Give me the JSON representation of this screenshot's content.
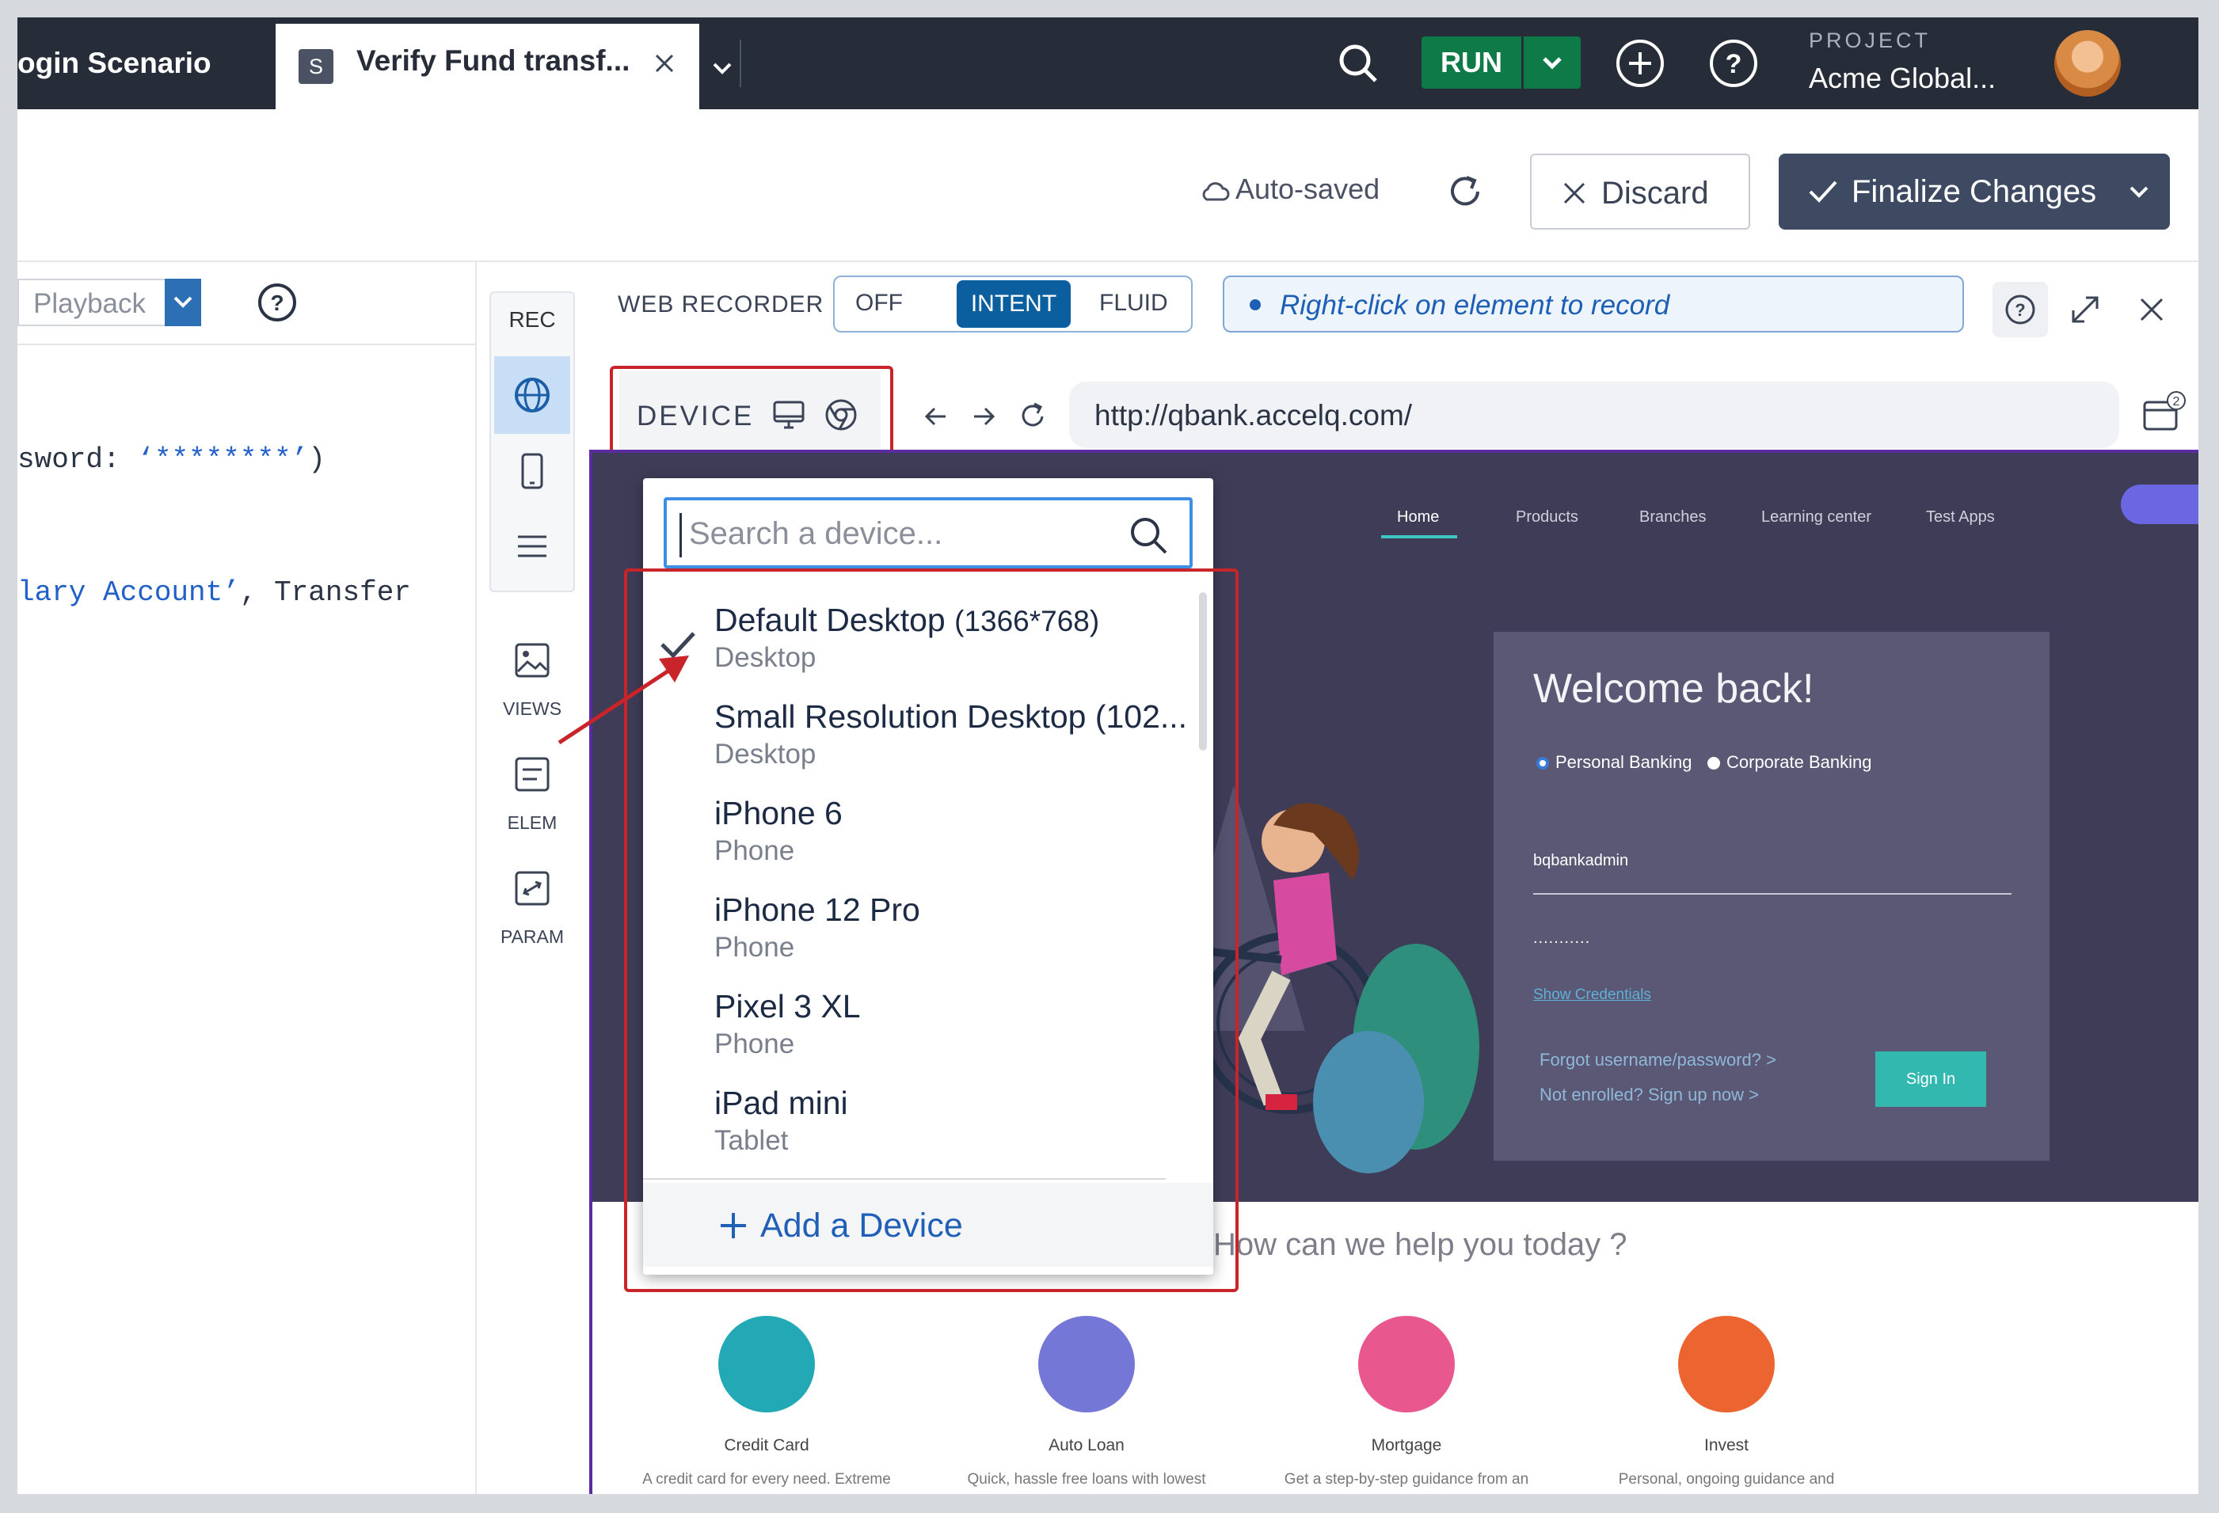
{
  "topbar": {
    "prev_tab": "ogin Scenario",
    "active_tab_badge": "S",
    "active_tab_title": "Verify Fund transf...",
    "run_label": "RUN",
    "project_label": "PROJECT",
    "project_name": "Acme Global..."
  },
  "toolbar": {
    "autosave": "Auto-saved",
    "discard": "Discard",
    "finalize": "Finalize Changes"
  },
  "editor": {
    "playback": "Playback",
    "lines": [
      {
        "pre": "sword: ",
        "str": "‘********’",
        "post": ")"
      },
      {
        "pre": "",
        "str": "lary Account’",
        "post": ", Transfer"
      }
    ]
  },
  "rail": {
    "rec": "REC",
    "views": "VIEWS",
    "elem": "ELEM",
    "param": "PARAM"
  },
  "recorder": {
    "title": "WEB RECORDER",
    "modes": [
      "OFF",
      "INTENT",
      "FLUID"
    ],
    "active_mode": "INTENT",
    "hint": "Right-click on element to record",
    "device_label": "DEVICE",
    "url": "http://qbank.accelq.com/",
    "tabs_count": "2"
  },
  "device_dropdown": {
    "placeholder": "Search a device...",
    "items": [
      {
        "name": "Default Desktop",
        "res": "(1366*768)",
        "type": "Desktop",
        "selected": true
      },
      {
        "name": "Small Resolution Desktop (102...",
        "res": "",
        "type": "Desktop",
        "selected": false
      },
      {
        "name": "iPhone 6",
        "res": "",
        "type": "Phone",
        "selected": false
      },
      {
        "name": "iPhone 12 Pro",
        "res": "",
        "type": "Phone",
        "selected": false
      },
      {
        "name": "Pixel 3 XL",
        "res": "",
        "type": "Phone",
        "selected": false
      },
      {
        "name": "iPad mini",
        "res": "",
        "type": "Tablet",
        "selected": false
      }
    ],
    "add_label": "Add a Device"
  },
  "site": {
    "nav": [
      "Home",
      "Products",
      "Branches",
      "Learning center",
      "Test Apps"
    ],
    "card_title": "Welcome back!",
    "radio_personal": "Personal Banking",
    "radio_corporate": "Corporate Banking",
    "username": "bqbankadmin",
    "password": "...........",
    "show_credentials": "Show Credentials",
    "forgot": "Forgot username/password?  >",
    "enroll": "Not enrolled? Sign up now  >",
    "signin": "Sign In",
    "help": "How can we help you today ?",
    "services": [
      {
        "name": "Credit Card",
        "desc": "A credit card for every need. Extreme",
        "color": "#22a9b5"
      },
      {
        "name": "Auto Loan",
        "desc": "Quick, hassle free loans with lowest",
        "color": "#7577d6"
      },
      {
        "name": "Mortgage",
        "desc": "Get a step-by-step guidance from an",
        "color": "#e8578e"
      },
      {
        "name": "Invest",
        "desc": "Personal, ongoing guidance and",
        "color": "#ec6530"
      }
    ]
  },
  "colors": {
    "topbar": "#262c38",
    "run": "#0e7a47",
    "finalize": "#3e4a62",
    "intent": "#0c5f9e",
    "highlight": "#c8242a",
    "hero": "#3f3c58"
  }
}
